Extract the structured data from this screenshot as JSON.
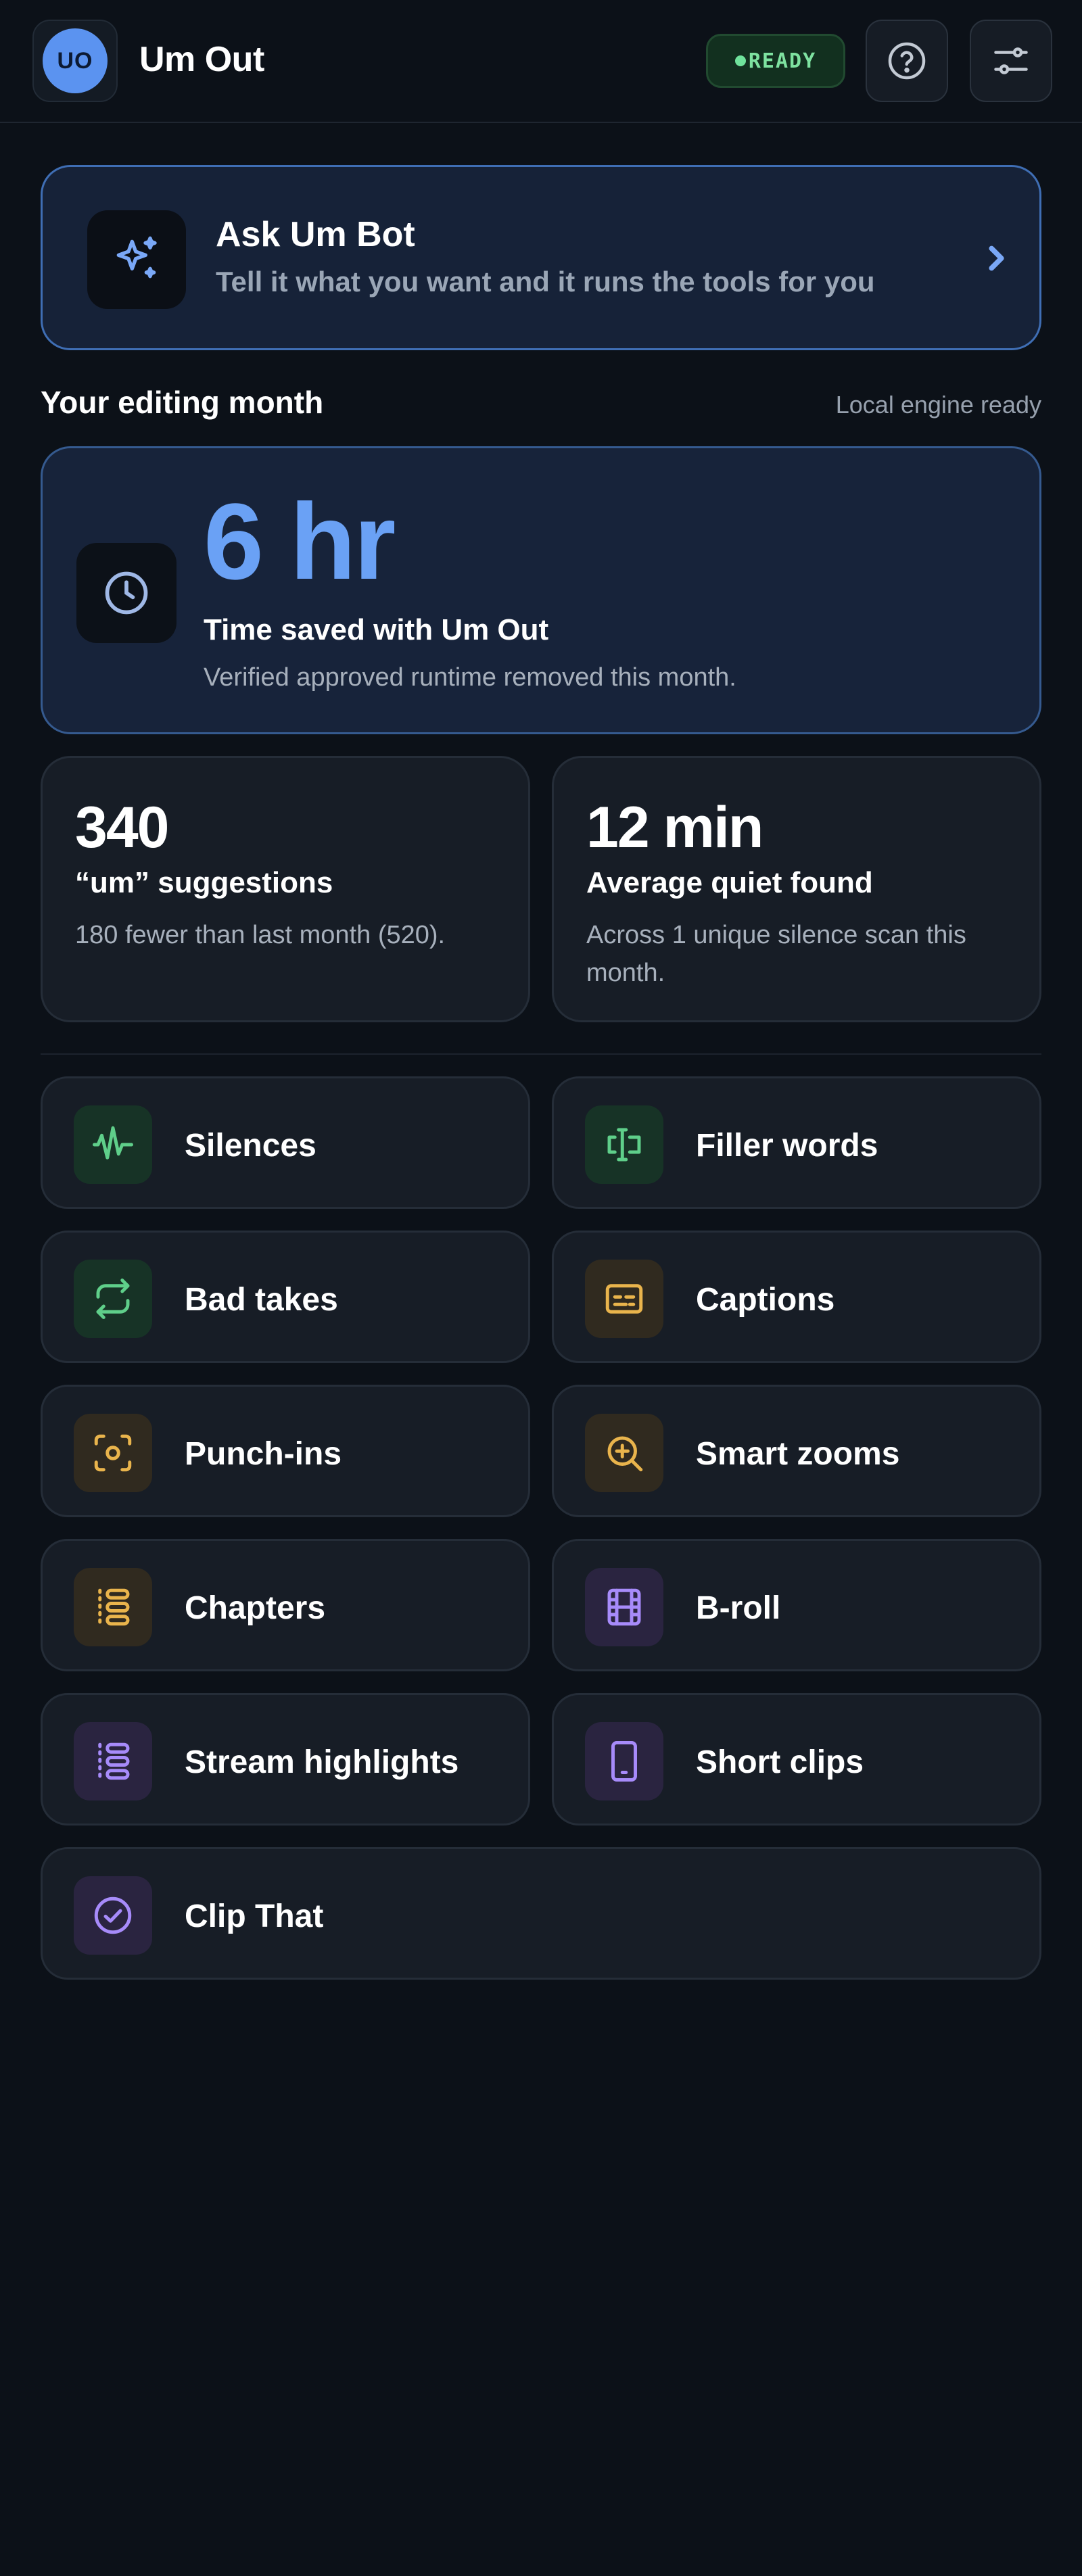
{
  "header": {
    "avatar_initials": "UO",
    "title": "Um Out",
    "status_badge": "READY",
    "help_icon": "question-circle-icon",
    "settings_icon": "sliders-icon"
  },
  "ask_bot": {
    "title": "Ask Um Bot",
    "subtitle": "Tell it what you want and it runs the tools for you",
    "icon": "sparkles-icon",
    "chevron": "›"
  },
  "month": {
    "section_title": "Your editing month",
    "engine_status": "Local engine ready",
    "time_saved": {
      "value": "6 hr",
      "label": "Time saved with Um Out",
      "subtitle": "Verified approved runtime removed this month."
    },
    "stats": [
      {
        "value": "340",
        "label": "“um” suggestions",
        "subtitle": "180 fewer than last month (520)."
      },
      {
        "value": "12 min",
        "label": "Average quiet found",
        "subtitle": "Across 1 unique silence scan this month."
      }
    ]
  },
  "tools": [
    {
      "label": "Silences",
      "icon": "waveform-icon",
      "color": "#5fcf8a"
    },
    {
      "label": "Filler words",
      "icon": "text-cursor-icon",
      "color": "#5fcf8a"
    },
    {
      "label": "Bad takes",
      "icon": "repeat-icon",
      "color": "#5fcf8a"
    },
    {
      "label": "Captions",
      "icon": "captions-icon",
      "color": "#e9b44c"
    },
    {
      "label": "Punch-ins",
      "icon": "focus-frame-icon",
      "color": "#e9b44c"
    },
    {
      "label": "Smart zooms",
      "icon": "zoom-in-icon",
      "color": "#e9b44c"
    },
    {
      "label": "Chapters",
      "icon": "chapters-list-icon",
      "color": "#e9b44c"
    },
    {
      "label": "B-roll",
      "icon": "film-icon",
      "color": "#a78bfa"
    },
    {
      "label": "Stream highlights",
      "icon": "stream-list-icon",
      "color": "#a78bfa"
    },
    {
      "label": "Short clips",
      "icon": "phone-icon",
      "color": "#a78bfa"
    },
    {
      "label": "Clip That",
      "icon": "check-circle-icon",
      "color": "#a78bfa"
    }
  ]
}
